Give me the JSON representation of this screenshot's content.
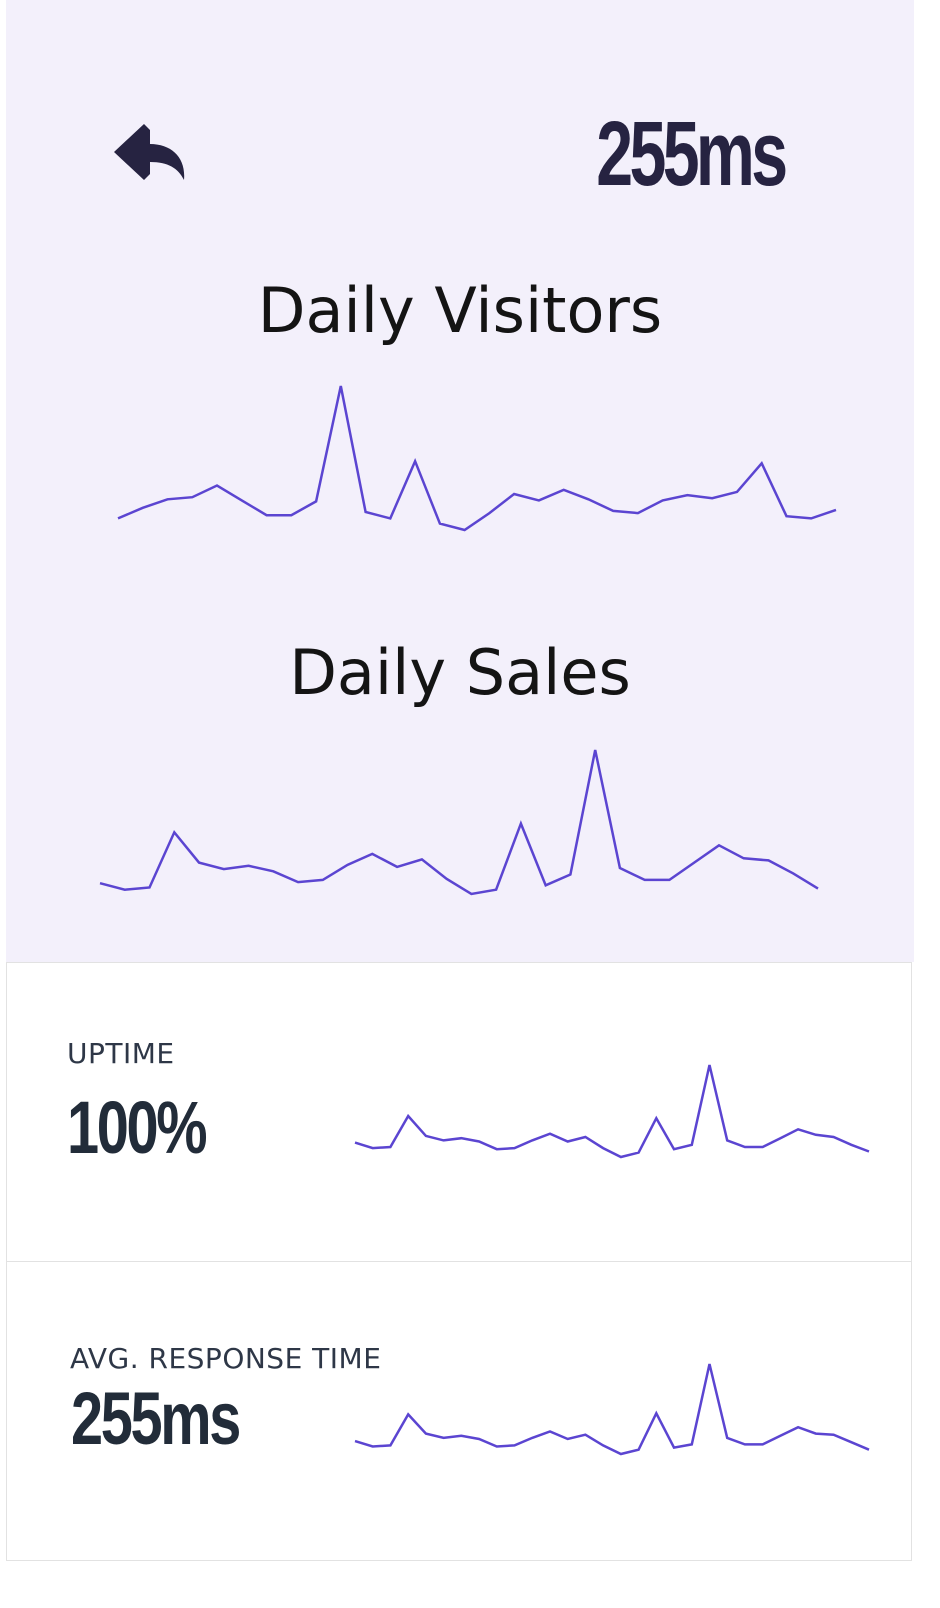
{
  "header": {
    "back_icon": "reply-arrow-icon",
    "metric": "255ms"
  },
  "accent_color": "#5b45d1",
  "hero_background": "#f3f0fb",
  "charts": [
    {
      "title": "Daily Visitors",
      "chart_data": {
        "type": "line",
        "values": [
          7,
          17,
          25,
          27,
          38,
          24,
          10,
          10,
          23,
          132,
          13,
          7,
          61,
          2,
          -4,
          12,
          30,
          24,
          34,
          25,
          14,
          12,
          24,
          29,
          26,
          32,
          59,
          9,
          7,
          15
        ]
      }
    },
    {
      "title": "Daily Sales",
      "chart_data": {
        "type": "line",
        "values": [
          7,
          1,
          3,
          54,
          26,
          20,
          23,
          18,
          8,
          10,
          24,
          34,
          22,
          29,
          11,
          -3,
          1,
          62,
          5,
          15,
          130,
          21,
          10,
          10,
          26,
          42,
          30,
          28,
          16,
          2
        ]
      }
    }
  ],
  "cards": [
    {
      "label": "UPTIME",
      "value": "100%",
      "chart_data": {
        "type": "line",
        "values": [
          10,
          5,
          6,
          34,
          16,
          12,
          14,
          11,
          4,
          5,
          12,
          18,
          11,
          15,
          5,
          -3,
          1,
          32,
          4,
          8,
          80,
          12,
          6,
          6,
          14,
          22,
          17,
          15,
          8,
          2
        ]
      }
    },
    {
      "label": "AVG. RESPONSE TIME",
      "value": "255ms",
      "chart_data": {
        "type": "line",
        "values": [
          8,
          3,
          4,
          33,
          15,
          11,
          13,
          10,
          3,
          4,
          11,
          17,
          10,
          14,
          4,
          -4,
          0,
          34,
          2,
          5,
          80,
          11,
          5,
          5,
          13,
          21,
          15,
          14,
          7,
          0
        ]
      }
    }
  ]
}
